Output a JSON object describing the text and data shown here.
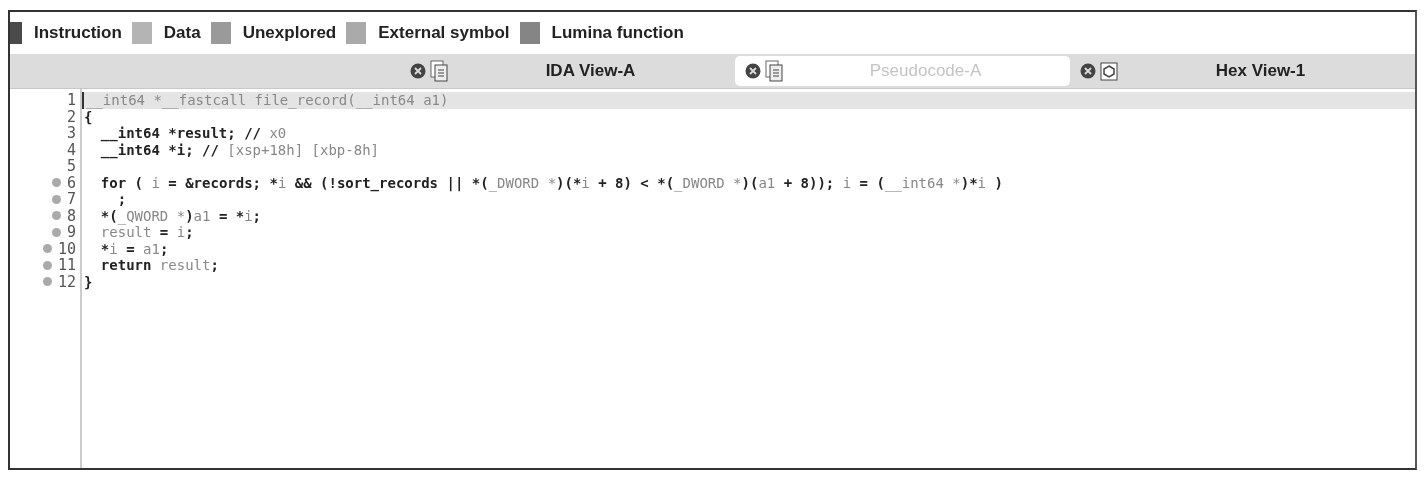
{
  "legend": [
    {
      "label": "Instruction",
      "color": "#4a4a4a"
    },
    {
      "label": "Data",
      "color": "#b4b4b4"
    },
    {
      "label": "Unexplored",
      "color": "#9a9a9a"
    },
    {
      "label": "External symbol",
      "color": "#aaaaaa"
    },
    {
      "label": "Lumina function",
      "color": "#858585"
    }
  ],
  "tabs": [
    {
      "label": "IDA View-A",
      "kind": "listing",
      "selected": false
    },
    {
      "label": "Pseudocode-A",
      "kind": "listing",
      "selected": true
    },
    {
      "label": "Hex View-1",
      "kind": "hex",
      "selected": false
    }
  ],
  "code": [
    {
      "number": "1",
      "marker": false,
      "current": true,
      "segments": [
        {
          "text": "__int64 *__fastcall file_record(__int64 a1)",
          "bold": false
        }
      ]
    },
    {
      "number": "2",
      "marker": false,
      "current": false,
      "segments": [
        {
          "text": "{",
          "bold": true
        }
      ]
    },
    {
      "number": "3",
      "marker": false,
      "current": false,
      "segments": [
        {
          "text": "  __int64 *result; //",
          "bold": true
        },
        {
          "text": " x0",
          "bold": false
        }
      ]
    },
    {
      "number": "4",
      "marker": false,
      "current": false,
      "segments": [
        {
          "text": "  __int64 *i; //",
          "bold": true
        },
        {
          "text": " [xsp+18h] [xbp-8h]",
          "bold": false
        }
      ]
    },
    {
      "number": "5",
      "marker": false,
      "current": false
    },
    {
      "number": "6",
      "marker": true,
      "current": false,
      "segments": [
        {
          "text": "  for ( ",
          "bold": true
        },
        {
          "text": "i",
          "bold": false
        },
        {
          "text": " = &records; *",
          "bold": true
        },
        {
          "text": "i",
          "bold": false
        },
        {
          "text": " && (!sort_records || *(",
          "bold": true
        },
        {
          "text": "_DWORD *",
          "bold": false
        },
        {
          "text": ")(*",
          "bold": true
        },
        {
          "text": "i",
          "bold": false
        },
        {
          "text": " + 8) < *(",
          "bold": true
        },
        {
          "text": "_DWORD *",
          "bold": false
        },
        {
          "text": ")(",
          "bold": true
        },
        {
          "text": "a1",
          "bold": false
        },
        {
          "text": " + 8)); ",
          "bold": true
        },
        {
          "text": "i",
          "bold": false
        },
        {
          "text": " = (",
          "bold": true
        },
        {
          "text": "__int64 *",
          "bold": false
        },
        {
          "text": ")*",
          "bold": true
        },
        {
          "text": "i",
          "bold": false
        },
        {
          "text": " )",
          "bold": true
        }
      ]
    },
    {
      "number": "7",
      "marker": true,
      "current": false,
      "segments": [
        {
          "text": "    ;",
          "bold": true
        }
      ]
    },
    {
      "number": "8",
      "marker": true,
      "current": false,
      "segments": [
        {
          "text": "  *(",
          "bold": true
        },
        {
          "text": "_QWORD *",
          "bold": false
        },
        {
          "text": ")",
          "bold": true
        },
        {
          "text": "a1",
          "bold": false
        },
        {
          "text": " = *",
          "bold": true
        },
        {
          "text": "i",
          "bold": false
        },
        {
          "text": ";",
          "bold": true
        }
      ]
    },
    {
      "number": "9",
      "marker": true,
      "current": false,
      "segments": [
        {
          "text": "  result",
          "bold": false
        },
        {
          "text": " = ",
          "bold": true
        },
        {
          "text": "i",
          "bold": false
        },
        {
          "text": ";",
          "bold": true
        }
      ]
    },
    {
      "number": "10",
      "marker": true,
      "current": false,
      "segments": [
        {
          "text": "  *",
          "bold": true
        },
        {
          "text": "i",
          "bold": false
        },
        {
          "text": " = ",
          "bold": true
        },
        {
          "text": "a1",
          "bold": false
        },
        {
          "text": ";",
          "bold": true
        }
      ]
    },
    {
      "number": "11",
      "marker": true,
      "current": false,
      "segments": [
        {
          "text": "  return ",
          "bold": true
        },
        {
          "text": "result",
          "bold": false
        },
        {
          "text": ";",
          "bold": true
        }
      ]
    },
    {
      "number": "12",
      "marker": true,
      "current": false,
      "segments": [
        {
          "text": "}",
          "bold": true
        }
      ]
    }
  ]
}
